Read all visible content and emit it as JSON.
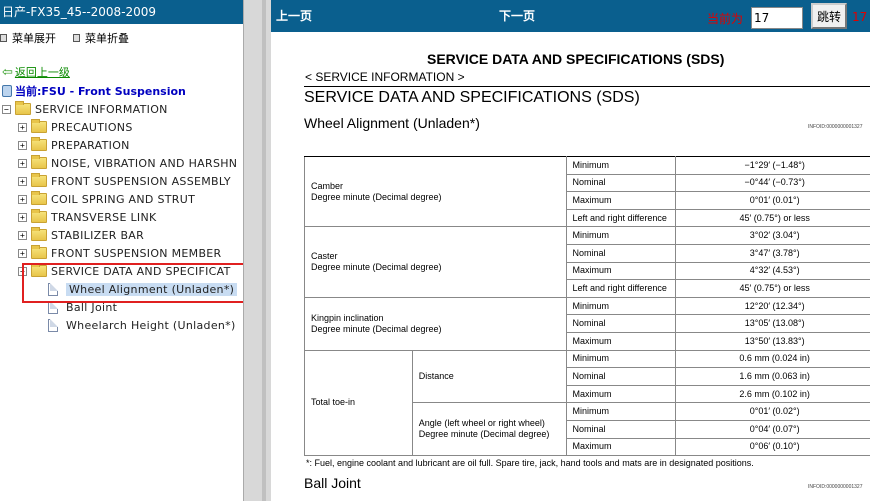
{
  "window": {
    "title": "日产-FX35_45--2008-2009"
  },
  "menu": {
    "expand_label": "菜单展开",
    "collapse_label": "菜单折叠"
  },
  "nav": {
    "back_label": "返回上一级",
    "current_label": "当前:FSU - Front Suspension"
  },
  "tree": {
    "root": "SERVICE INFORMATION",
    "items": [
      "PRECAUTIONS",
      "PREPARATION",
      "NOISE, VIBRATION AND HARSHN",
      "FRONT SUSPENSION ASSEMBLY",
      "COIL SPRING AND STRUT",
      "TRANSVERSE LINK",
      "STABILIZER BAR",
      "FRONT SUSPENSION MEMBER",
      "SERVICE DATA AND SPECIFICAT"
    ],
    "children": [
      "Wheel Alignment (Unladen*)",
      "Ball Joint",
      "Wheelarch Height (Unladen*)"
    ]
  },
  "toolbar": {
    "prev_label": "上一页",
    "next_label": "下一页",
    "page_label": "当前为",
    "page_value": "17",
    "jump_label": "跳转",
    "total_value": "17"
  },
  "doc": {
    "title": "SERVICE DATA AND SPECIFICATIONS (SDS)",
    "service_info": "< SERVICE INFORMATION >",
    "section_title": "SERVICE DATA AND SPECIFICATIONS (SDS)",
    "subsection": "Wheel Alignment (Unladen*)",
    "ref_code_1": "INFOID:0000000001327",
    "ref_code_2": "INFOID:0000000001327",
    "note": "*: Fuel, engine coolant and lubricant are oil full. Spare tire, jack, hand tools and mats are in designated positions.",
    "next_subsection": "Ball Joint"
  },
  "table": {
    "camber": {
      "label": "Camber",
      "unit": "Degree minute (Decimal degree)",
      "min_l": "Minimum",
      "min_v": "−1°29′ (−1.48°)",
      "nom_l": "Nominal",
      "nom_v": "−0°44′ (−0.73°)",
      "max_l": "Maximum",
      "max_v": "0°01′ (0.01°)",
      "diff_l": "Left and right difference",
      "diff_v": "45′ (0.75°) or less"
    },
    "caster": {
      "label": "Caster",
      "unit": "Degree minute (Decimal degree)",
      "min_l": "Minimum",
      "min_v": "3°02′ (3.04°)",
      "nom_l": "Nominal",
      "nom_v": "3°47′ (3.78°)",
      "max_l": "Maximum",
      "max_v": "4°32′ (4.53°)",
      "diff_l": "Left and right difference",
      "diff_v": "45′ (0.75°) or less"
    },
    "kingpin": {
      "label": "Kingpin inclination",
      "unit": "Degree minute (Decimal degree)",
      "min_l": "Minimum",
      "min_v": "12°20′ (12.34°)",
      "nom_l": "Nominal",
      "nom_v": "13°05′ (13.08°)",
      "max_l": "Maximum",
      "max_v": "13°50′ (13.83°)"
    },
    "toe": {
      "label": "Total toe-in",
      "distance": {
        "label": "Distance",
        "min_l": "Minimum",
        "min_v": "0.6 mm (0.024 in)",
        "nom_l": "Nominal",
        "nom_v": "1.6 mm (0.063 in)",
        "max_l": "Maximum",
        "max_v": "2.6 mm (0.102 in)"
      },
      "angle": {
        "label": "Angle (left wheel or right wheel)",
        "unit": "Degree minute (Decimal degree)",
        "min_l": "Minimum",
        "min_v": "0°01′ (0.02°)",
        "nom_l": "Nominal",
        "nom_v": "0°04′ (0.07°)",
        "max_l": "Maximum",
        "max_v": "0°06′ (0.10°)"
      }
    }
  }
}
